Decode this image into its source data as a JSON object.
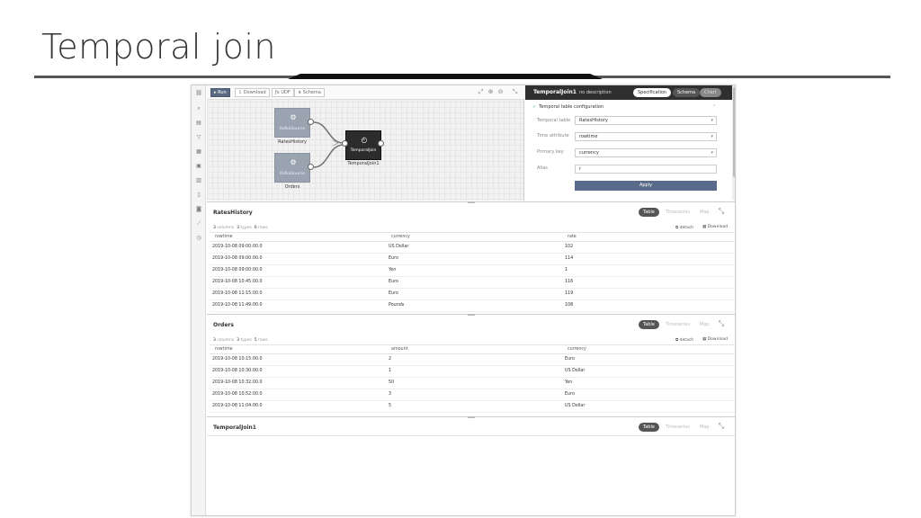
{
  "slide": {
    "title": "Temporal join"
  },
  "toolbar": {
    "run": "Run",
    "download": "Download",
    "udf": "UDF",
    "schema": "Schema"
  },
  "rail_icons": [
    "chain-icon",
    "search-icon",
    "database-icon",
    "filter-icon",
    "table-icon",
    "window-icon",
    "sink-icon",
    "document-icon",
    "save-icon",
    "chart-icon",
    "clock-icon"
  ],
  "canvas": {
    "nodes": [
      {
        "name": "kafka-source-rates",
        "text": "KafkaSource",
        "label": "RatesHistory"
      },
      {
        "name": "kafka-source-orders",
        "text": "KafkaSource",
        "label": "Orders"
      },
      {
        "name": "temporal-join-node",
        "text": "TemporalJoin",
        "label": "TemporalJoin1"
      }
    ]
  },
  "spec": {
    "title": "TemporalJoin1",
    "description": "no description",
    "tabs": [
      "Specification",
      "Schema",
      "Chart"
    ],
    "section": "Temporal table configuration",
    "fields": [
      {
        "label": "Temporal table",
        "value": "RatesHistory",
        "dropdown": true
      },
      {
        "label": "Time attribute",
        "value": "rowtime",
        "dropdown": true
      },
      {
        "label": "Primary key",
        "value": "currency",
        "dropdown": true
      },
      {
        "label": "Alias",
        "value": "r",
        "dropdown": false
      }
    ],
    "apply": "Apply"
  },
  "panel_tabs": [
    "Table",
    "Timeseries",
    "Map"
  ],
  "panel_actions": {
    "detach": "detach",
    "download": "Download"
  },
  "panels": [
    {
      "title": "RatesHistory",
      "stats": {
        "columns": "3",
        "columns_label": "columns",
        "types": "3",
        "types_label": "types",
        "rows": "6",
        "rows_label": "rows"
      },
      "columns": [
        "rowtime",
        "currency",
        "rate"
      ],
      "rows": [
        [
          "2019-10-08 09:00:00.0",
          "US Dollar",
          "102"
        ],
        [
          "2019-10-08 09:00:00.0",
          "Euro",
          "114"
        ],
        [
          "2019-10-08 09:00:00.0",
          "Yen",
          "1"
        ],
        [
          "2019-10-08 10:45:00.0",
          "Euro",
          "116"
        ],
        [
          "2019-10-08 11:15:00.0",
          "Euro",
          "119"
        ],
        [
          "2019-10-08 11:49:00.0",
          "Pounds",
          "108"
        ]
      ]
    },
    {
      "title": "Orders",
      "stats": {
        "columns": "3",
        "columns_label": "columns",
        "types": "3",
        "types_label": "types",
        "rows": "5",
        "rows_label": "rows"
      },
      "columns": [
        "rowtime",
        "amount",
        "currency"
      ],
      "rows": [
        [
          "2019-10-08 10:15:00.0",
          "2",
          "Euro"
        ],
        [
          "2019-10-08 10:30:00.0",
          "1",
          "US Dollar"
        ],
        [
          "2019-10-08 10:32:00.0",
          "50",
          "Yen"
        ],
        [
          "2019-10-08 10:52:00.0",
          "3",
          "Euro"
        ],
        [
          "2019-10-08 11:04:00.0",
          "5",
          "US Dollar"
        ]
      ]
    },
    {
      "title": "TemporalJoin1"
    }
  ]
}
